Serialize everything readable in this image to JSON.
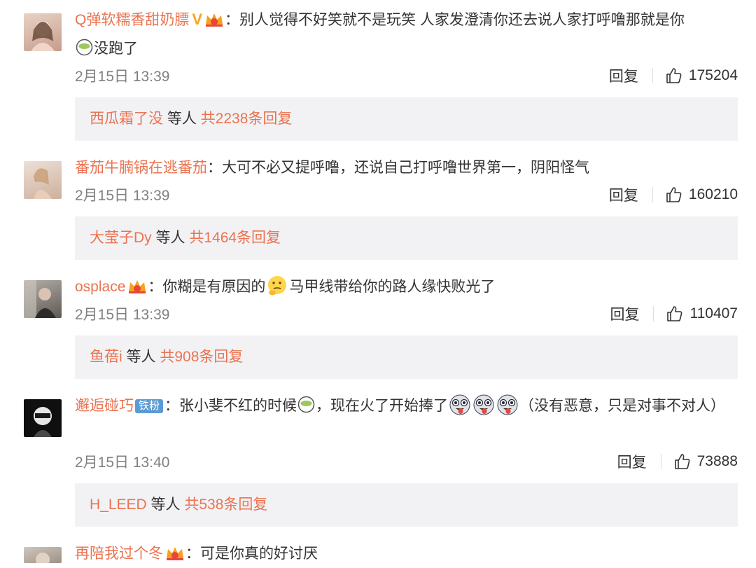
{
  "comments": [
    {
      "username": "Q弹软糯香甜奶膘",
      "has_v_badge": true,
      "v_badge": "V",
      "text_before": "：别人觉得不好笑就不是玩笑 人家发澄清你还去说人家打呼噜那就是你",
      "text_after": "没跑了",
      "date": "2月15日 13:39",
      "reply_label": "回复",
      "likes": "175204",
      "reply_user": "西瓜霜了没",
      "reply_mid": " 等人 ",
      "reply_count": "共2238条回复",
      "avatar_color": "#d9b7a8"
    },
    {
      "username": "番茄牛腩锅在逃番茄",
      "text": "：大可不必又提呼噜，还说自己打呼噜世界第一，阴阳怪气",
      "date": "2月15日 13:39",
      "reply_label": "回复",
      "likes": "160210",
      "reply_user": "大莹子Dy",
      "reply_mid": " 等人 ",
      "reply_count": "共1464条回复",
      "avatar_color": "#d8c2b3"
    },
    {
      "username": "osplace",
      "text_before": "：你糊是有原因的",
      "text_after": "马甲线带给你的路人缘快败光了",
      "date": "2月15日 13:39",
      "reply_label": "回复",
      "likes": "110407",
      "reply_user": "鱼蓓i",
      "reply_mid": " 等人 ",
      "reply_count": "共908条回复",
      "avatar_color": "#8c8883"
    },
    {
      "username": "邂逅碰巧",
      "fan_badge": "铁粉",
      "text_before": "：张小斐不红的时候",
      "text_mid": "，现在火了开始捧了",
      "text_after": "（没有恶意，只是对事不对人）",
      "date": "2月15日 13:40",
      "reply_label": "回复",
      "likes": "73888",
      "reply_user": "H_LEED",
      "reply_mid": " 等人 ",
      "reply_count": "共538条回复",
      "avatar_color": "#1a1a1a"
    },
    {
      "username": "再陪我过个冬",
      "text": "：可是你真的好讨厌",
      "avatar_color": "#b9aea4"
    }
  ],
  "colors": {
    "username": "#eb7350",
    "reply_box_bg": "#f2f2f5",
    "meta_text": "#808080"
  },
  "icons": [
    "thumbs-up-icon",
    "crown-badge-icon",
    "v-badge-icon",
    "matcha-emoji-icon",
    "thinking-emoji-icon",
    "tongue-emoji-icon"
  ]
}
